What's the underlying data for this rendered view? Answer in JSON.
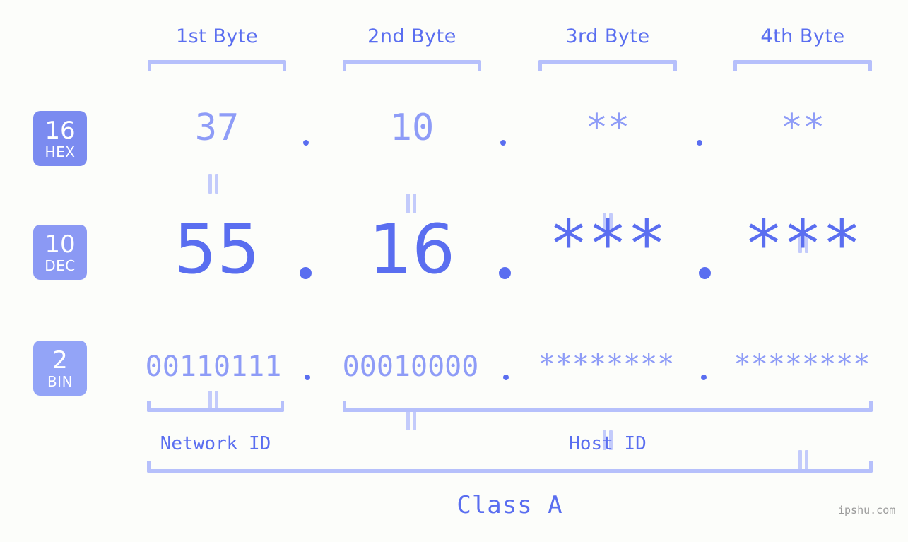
{
  "background_color": "#fcfdfa",
  "accent_color": "#5a6ef0",
  "muted_color": "#8e9cf7",
  "bracket_color": "#b6c0fb",
  "headers": [
    {
      "label": "1st Byte"
    },
    {
      "label": "2nd Byte"
    },
    {
      "label": "3rd Byte"
    },
    {
      "label": "4th Byte"
    }
  ],
  "bases": [
    {
      "number": "16",
      "name": "HEX",
      "color": "#7b8bf0"
    },
    {
      "number": "10",
      "name": "DEC",
      "color": "#8b99f4"
    },
    {
      "number": "2",
      "name": "BIN",
      "color": "#93a4f7"
    }
  ],
  "separator": ".",
  "equals_symbol": "||",
  "rows": {
    "hex": {
      "values": [
        "37",
        "10",
        "**",
        "**"
      ]
    },
    "dec": {
      "values": [
        "55",
        "16",
        "***",
        "***"
      ]
    },
    "bin": {
      "values": [
        "00110111",
        "00010000",
        "********",
        "********"
      ]
    }
  },
  "sections": {
    "network_id": "Network ID",
    "host_id": "Host ID",
    "class": "Class A"
  },
  "watermark": "ipshu.com"
}
